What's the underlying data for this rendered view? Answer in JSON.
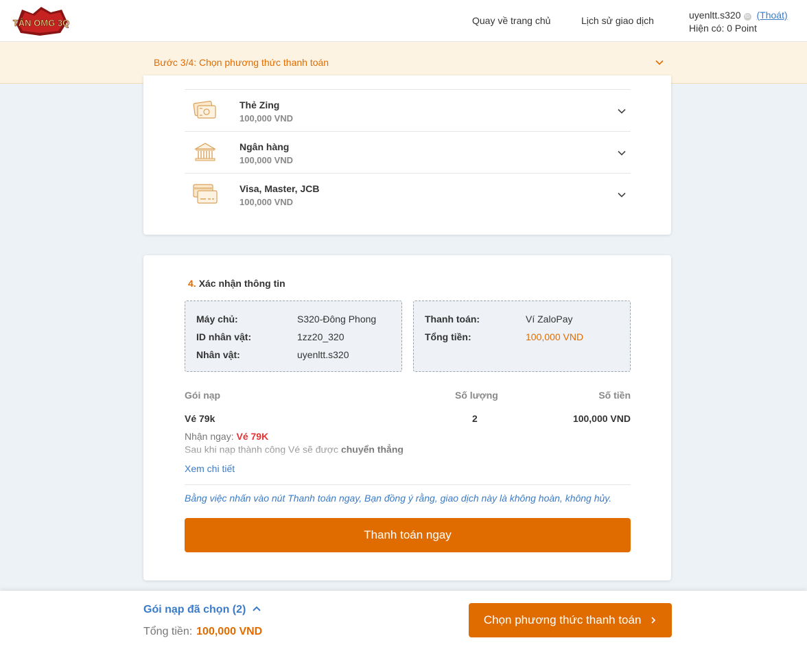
{
  "header": {
    "nav_home": "Quay về trang chủ",
    "nav_history": "Lịch sử giao dịch",
    "username": "uyenltt.s320",
    "logout": "(Thoát)",
    "balance": "Hiện có: 0 Point",
    "logo_text": "TÂN OMG 3Q"
  },
  "step": {
    "label": "Bước 3/4: Chọn phương thức thanh toán"
  },
  "methods": [
    {
      "name": "Thẻ Zing",
      "price": "100,000 VND",
      "icon": "card-icon"
    },
    {
      "name": "Ngân hàng",
      "price": "100,000 VND",
      "icon": "bank-icon"
    },
    {
      "name": "Visa, Master, JCB",
      "price": "100,000 VND",
      "icon": "credit-card-icon"
    }
  ],
  "confirm": {
    "number": "4.",
    "title": "Xác nhận thông tin",
    "server_label": "Máy chủ:",
    "server_value": "S320-Đông Phong",
    "char_id_label": "ID nhân vật:",
    "char_id_value": "1zz20_320",
    "char_label": "Nhân vật:",
    "char_value": "uyenltt.s320",
    "payment_label": "Thanh toán:",
    "payment_value": "Ví ZaloPay",
    "total_label": "Tổng tiền:",
    "total_value": "100,000 VND"
  },
  "table": {
    "col_package": "Gói nạp",
    "col_qty": "Số lượng",
    "col_amount": "Số tiền",
    "row": {
      "package": "Vé 79k",
      "qty": "2",
      "amount": "100,000 VND"
    },
    "receive_label": "Nhận ngay: ",
    "receive_value": "Vé 79K",
    "desc_prefix": "Sau khi nạp thành công Vé sẽ được ",
    "desc_bold": "chuyển thẳng",
    "view_detail": "Xem chi tiết"
  },
  "agreement": "Bằng việc nhấn vào nút Thanh toán ngay, Bạn đồng ý rằng, giao dịch này là không hoàn, không hủy.",
  "pay_now": "Thanh toán ngay",
  "footer": {
    "selected": "Gói nạp đã chọn (2)",
    "total_label": "Tổng tiền:",
    "total_value": "100,000 VND",
    "choose_button": "Chọn phương thức thanh toán"
  },
  "colors": {
    "accent": "#e06c00",
    "link": "#3a7bc8",
    "highlight": "#e03434"
  }
}
